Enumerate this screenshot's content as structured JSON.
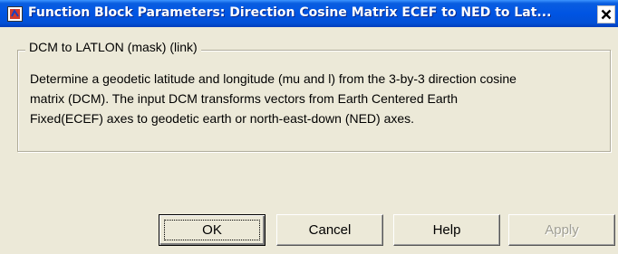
{
  "window": {
    "title": "Function Block Parameters: Direction Cosine Matrix ECEF to NED to Lat...",
    "icon": "simulink-block-icon",
    "close_icon": "close-icon"
  },
  "group": {
    "legend": "DCM to LATLON (mask) (link)",
    "description_lines": [
      "Determine a geodetic latitude and longitude (mu and l) from the 3-by-3 direction cosine",
      "matrix (DCM). The input DCM transforms vectors from Earth Centered Earth",
      "Fixed(ECEF) axes to geodetic earth or north-east-down (NED) axes."
    ]
  },
  "buttons": {
    "ok": "OK",
    "cancel": "Cancel",
    "help": "Help",
    "apply": "Apply"
  }
}
